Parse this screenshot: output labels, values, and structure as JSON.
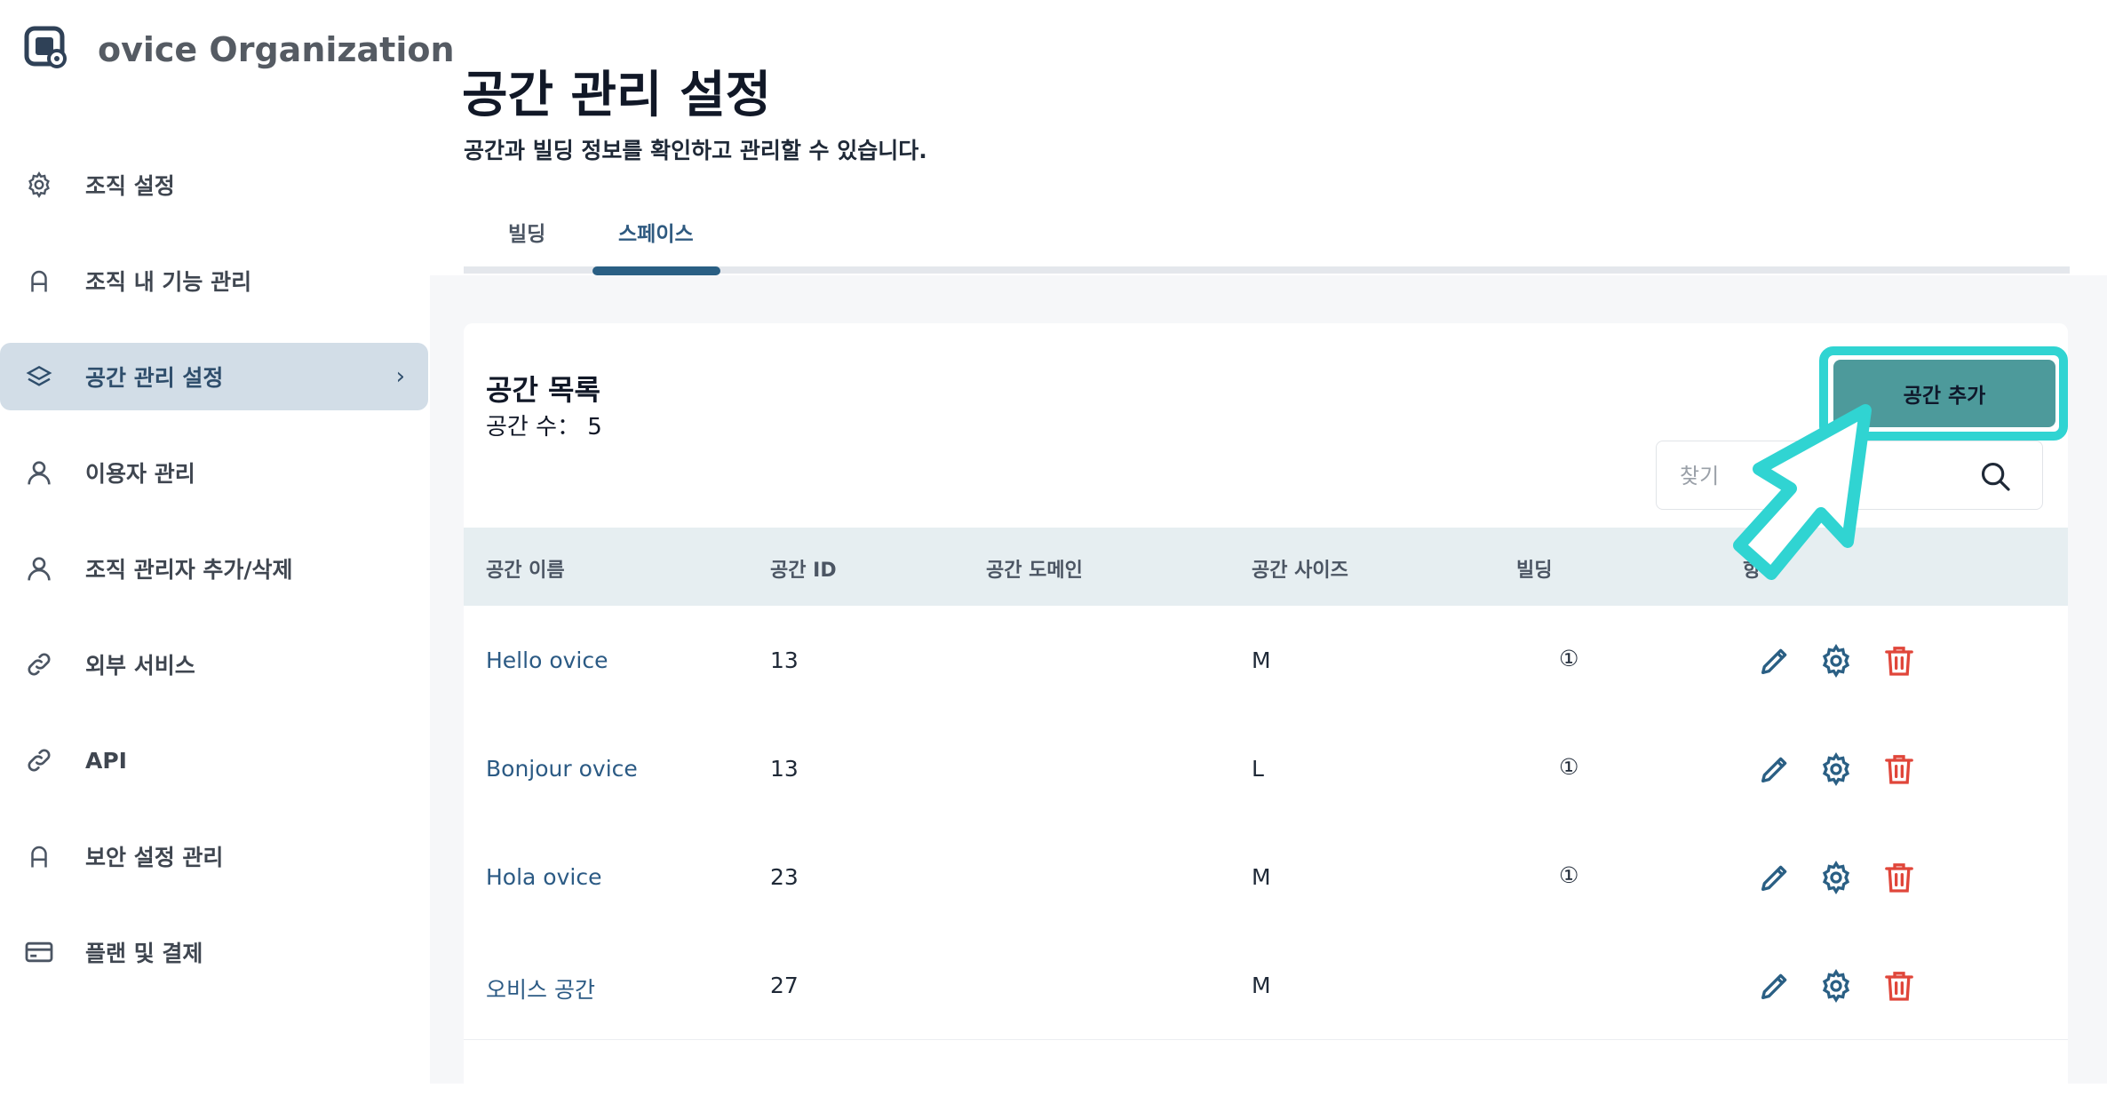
{
  "org": {
    "name": "ovice Organization"
  },
  "sidebar": {
    "items": [
      {
        "label": "조직 설정",
        "icon": "gear-icon"
      },
      {
        "label": "조직 내 기능 관리",
        "icon": "lock-icon"
      },
      {
        "label": "공간 관리 설정",
        "icon": "layers-icon",
        "active": true,
        "chevron": "›"
      },
      {
        "label": "이용자 관리",
        "icon": "user-icon"
      },
      {
        "label": "조직 관리자 추가/삭제",
        "icon": "user-icon"
      },
      {
        "label": "외부 서비스",
        "icon": "link-icon"
      },
      {
        "label": "API",
        "icon": "link-icon"
      },
      {
        "label": "보안 설정 관리",
        "icon": "lock-icon"
      },
      {
        "label": "플랜 및 결제",
        "icon": "card-icon"
      }
    ]
  },
  "page": {
    "title": "공간 관리 설정",
    "subtitle": "공간과 빌딩 정보를 확인하고 관리할 수 있습니다."
  },
  "tabs": [
    {
      "label": "빌딩"
    },
    {
      "label": "스페이스",
      "active": true
    }
  ],
  "list": {
    "title": "공간 목록",
    "count_label": "공간 수：",
    "count": "5",
    "add_button": "공간 추가",
    "search_placeholder": "찾기"
  },
  "table": {
    "headers": [
      "공간 이름",
      "공간 ID",
      "공간 도메인",
      "공간 사이즈",
      "빌딩",
      "항"
    ],
    "rows": [
      {
        "name": "Hello ovice",
        "id": "13",
        "domain": "",
        "size": "M",
        "building": "①"
      },
      {
        "name": "Bonjour ovice",
        "id": "13",
        "domain": "",
        "size": "L",
        "building": "①"
      },
      {
        "name": "Hola ovice",
        "id": "23",
        "domain": "",
        "size": "M",
        "building": "①"
      },
      {
        "name": "오비스 공간",
        "id": "27",
        "domain": "",
        "size": "M",
        "building": ""
      }
    ]
  },
  "colors": {
    "accent": "#2a5f84",
    "button": "#4d9a9b",
    "highlight": "#30d4d2",
    "danger": "#e0463a"
  }
}
